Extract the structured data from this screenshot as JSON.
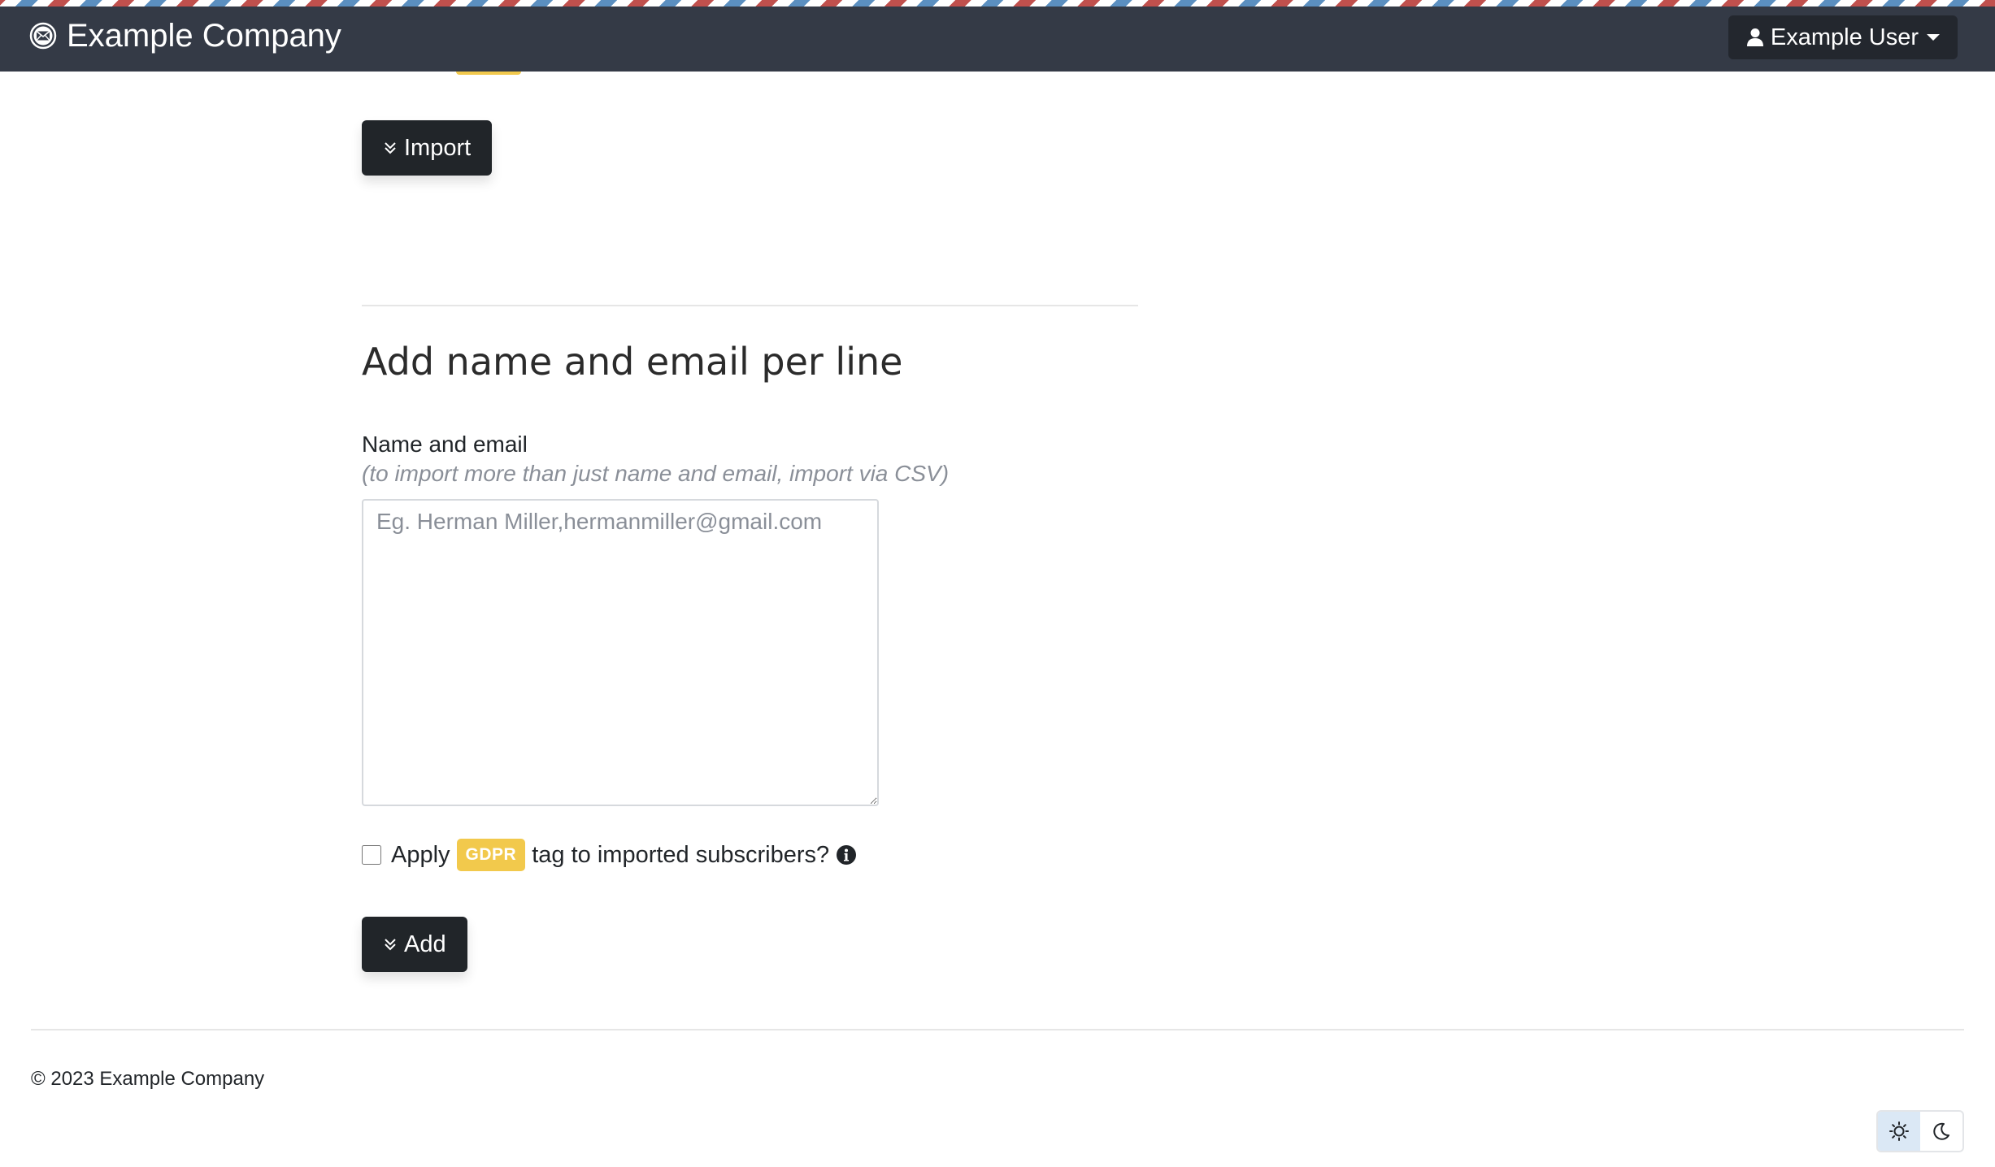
{
  "navbar": {
    "brand_name": "Example Company",
    "brand_icon": "envelope-circle-icon",
    "user_menu_label": "Example User",
    "user_icon": "user-icon"
  },
  "import_section": {
    "import_button_label": "Import",
    "button_icon": "double-chevron-down-icon"
  },
  "add_section": {
    "heading": "Add name and email per line",
    "field_label": "Name and email",
    "field_help": "(to import more than just name and email, import via CSV)",
    "textarea_placeholder": "Eg. Herman Miller,hermanmiller@gmail.com",
    "textarea_value": "",
    "gdpr_prefix": "Apply",
    "gdpr_badge": "GDPR",
    "gdpr_suffix": "tag to imported subscribers?",
    "gdpr_checked": false,
    "add_button_label": "Add"
  },
  "footer": {
    "copyright": "© 2023 Example Company"
  },
  "theme": {
    "active": "light",
    "light_icon": "sun-icon",
    "dark_icon": "moon-icon"
  },
  "colors": {
    "navbar": "#343a46",
    "button_dark": "#212529",
    "badge_gdpr": "#f2c94c",
    "stripe_red": "#c0504d",
    "stripe_blue": "#5b8fc0"
  }
}
